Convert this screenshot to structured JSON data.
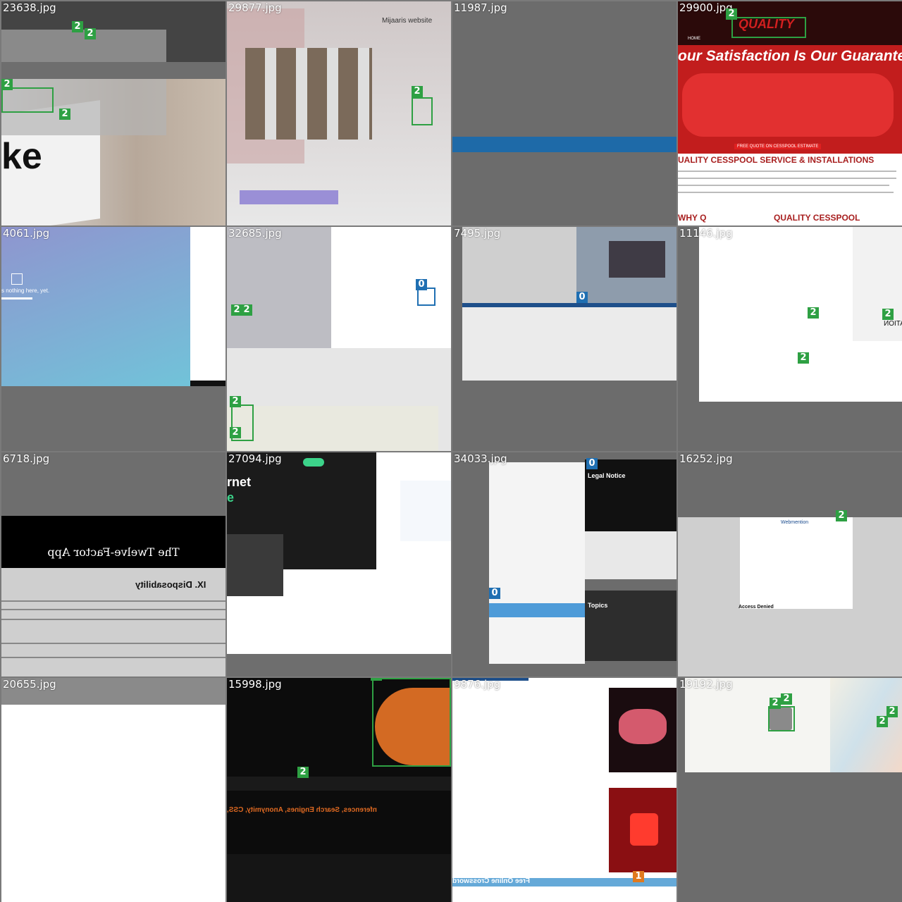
{
  "colors": {
    "class_0": "#1f6fb2",
    "class_1": "#e07a1f",
    "class_2": "#2ea043",
    "tile_bg": "#6e6e6e"
  },
  "tiles": [
    {
      "filename": "23638.jpg"
    },
    {
      "filename": "29877.jpg"
    },
    {
      "filename": "11987.jpg"
    },
    {
      "filename": "29900.jpg"
    },
    {
      "filename": "4061.jpg"
    },
    {
      "filename": "32685.jpg"
    },
    {
      "filename": "7495.jpg"
    },
    {
      "filename": "11146.jpg"
    },
    {
      "filename": "6718.jpg"
    },
    {
      "filename": "27094.jpg"
    },
    {
      "filename": "34033.jpg"
    },
    {
      "filename": "16252.jpg"
    },
    {
      "filename": "20655.jpg"
    },
    {
      "filename": "15998.jpg"
    },
    {
      "filename": "9876.jpg"
    },
    {
      "filename": "19192.jpg"
    }
  ],
  "texts": {
    "t3_slogan": "our Satisfaction Is Our Guarantee",
    "t3_heading": "UALITY CESSPOOL SERVICE & INSTALLATIONS",
    "t3_why": "WHY Q",
    "t3_why2": "QUALITY CESSPOOL",
    "t3_logo": "QUALITY",
    "t3_cta": "FREE QUOTE ON CESSPOOL ESTIMATE",
    "t4_text": "s nothing here, yet.",
    "t9_title": "The Twelve-Factor App",
    "t9_heading": "IX. Disposability",
    "t10_heading_1": "rnet",
    "t10_heading_2": "e",
    "t11_legal": "Legal Notice",
    "t11_topics": "Topics",
    "t14_cross": "Free Online Crossword",
    "t13_section": "nferences, Search Engines, Anonymity, CSS,",
    "t1_ke": "ke",
    "t8_ation": "ATION",
    "t2_site": "Mijaaris website",
    "t3_home": "HOME",
    "t12_site": "Webmention",
    "t12_access": "Access Denied"
  },
  "markers": [
    {
      "label": "2",
      "cls": 2
    },
    {
      "label": "2",
      "cls": 2
    },
    {
      "label": "2",
      "cls": 2
    },
    {
      "label": "2",
      "cls": 2
    },
    {
      "label": "2",
      "cls": 2
    },
    {
      "label": "2",
      "cls": 2
    },
    {
      "label": "0",
      "cls": 0
    },
    {
      "label": "2",
      "cls": 2
    },
    {
      "label": "0",
      "cls": 0
    },
    {
      "label": "2",
      "cls": 2
    },
    {
      "label": "0",
      "cls": 0
    },
    {
      "label": "0",
      "cls": 0
    },
    {
      "label": "2",
      "cls": 2
    },
    {
      "label": "2",
      "cls": 2
    },
    {
      "label": "1",
      "cls": 1
    },
    {
      "label": "2",
      "cls": 2
    }
  ]
}
